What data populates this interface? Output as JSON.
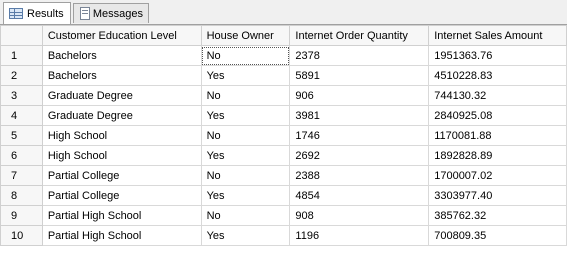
{
  "tabs": {
    "results": "Results",
    "messages": "Messages"
  },
  "icons": {
    "results": "grid-icon",
    "messages": "document-icon"
  },
  "grid": {
    "columns": [
      "",
      "Customer Education Level",
      "House Owner",
      "Internet Order Quantity",
      "Internet Sales Amount"
    ],
    "rows": [
      [
        "1",
        "Bachelors",
        "No",
        "2378",
        "1951363.76"
      ],
      [
        "2",
        "Bachelors",
        "Yes",
        "5891",
        "4510228.83"
      ],
      [
        "3",
        "Graduate Degree",
        "No",
        "906",
        "744130.32"
      ],
      [
        "4",
        "Graduate Degree",
        "Yes",
        "3981",
        "2840925.08"
      ],
      [
        "5",
        "High School",
        "No",
        "1746",
        "1170081.88"
      ],
      [
        "6",
        "High School",
        "Yes",
        "2692",
        "1892828.89"
      ],
      [
        "7",
        "Partial College",
        "No",
        "2388",
        "1700007.02"
      ],
      [
        "8",
        "Partial College",
        "Yes",
        "4854",
        "3303977.40"
      ],
      [
        "9",
        "Partial High School",
        "No",
        "908",
        "385762.32"
      ],
      [
        "10",
        "Partial High School",
        "Yes",
        "1196",
        "700809.35"
      ]
    ]
  }
}
